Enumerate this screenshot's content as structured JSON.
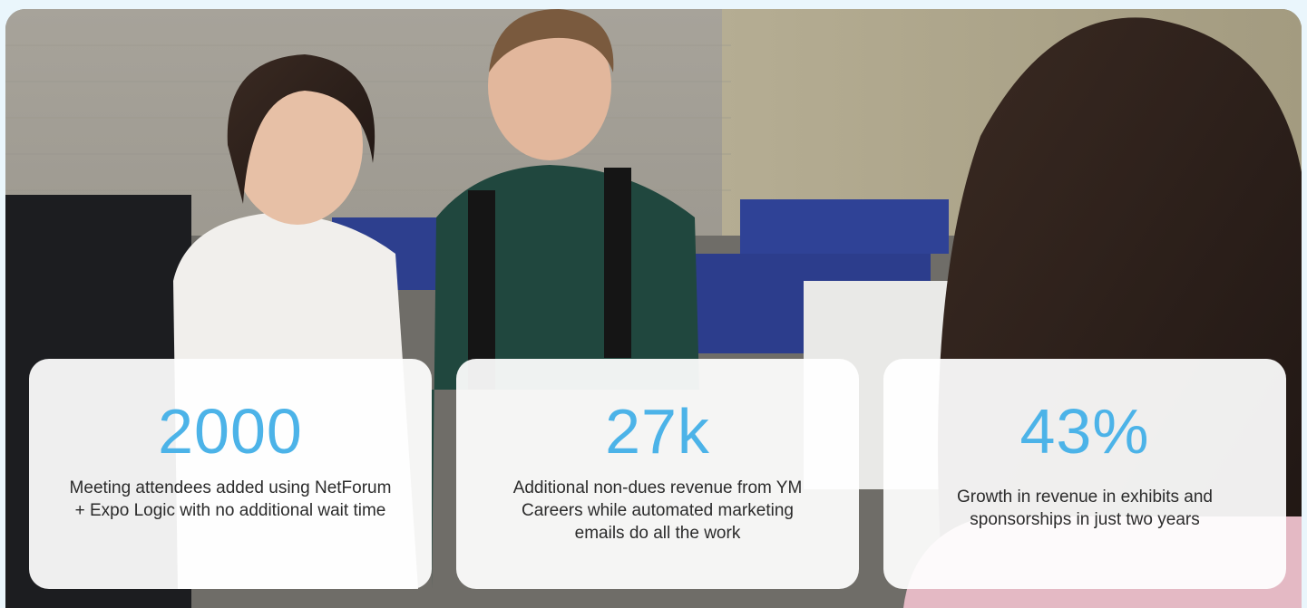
{
  "theme": {
    "accent": "#4cb3e8",
    "page_background": "#eaf6fc"
  },
  "stats": [
    {
      "value": "2000",
      "description": "Meeting attendees added using NetForum + Expo Logic with no additional wait time"
    },
    {
      "value": "27k",
      "description": "Additional non-dues revenue from YM Careers while automated marketing emails do all the work"
    },
    {
      "value": "43%",
      "description": "Growth in revenue in exhibits and sponsorships in just two years"
    }
  ]
}
